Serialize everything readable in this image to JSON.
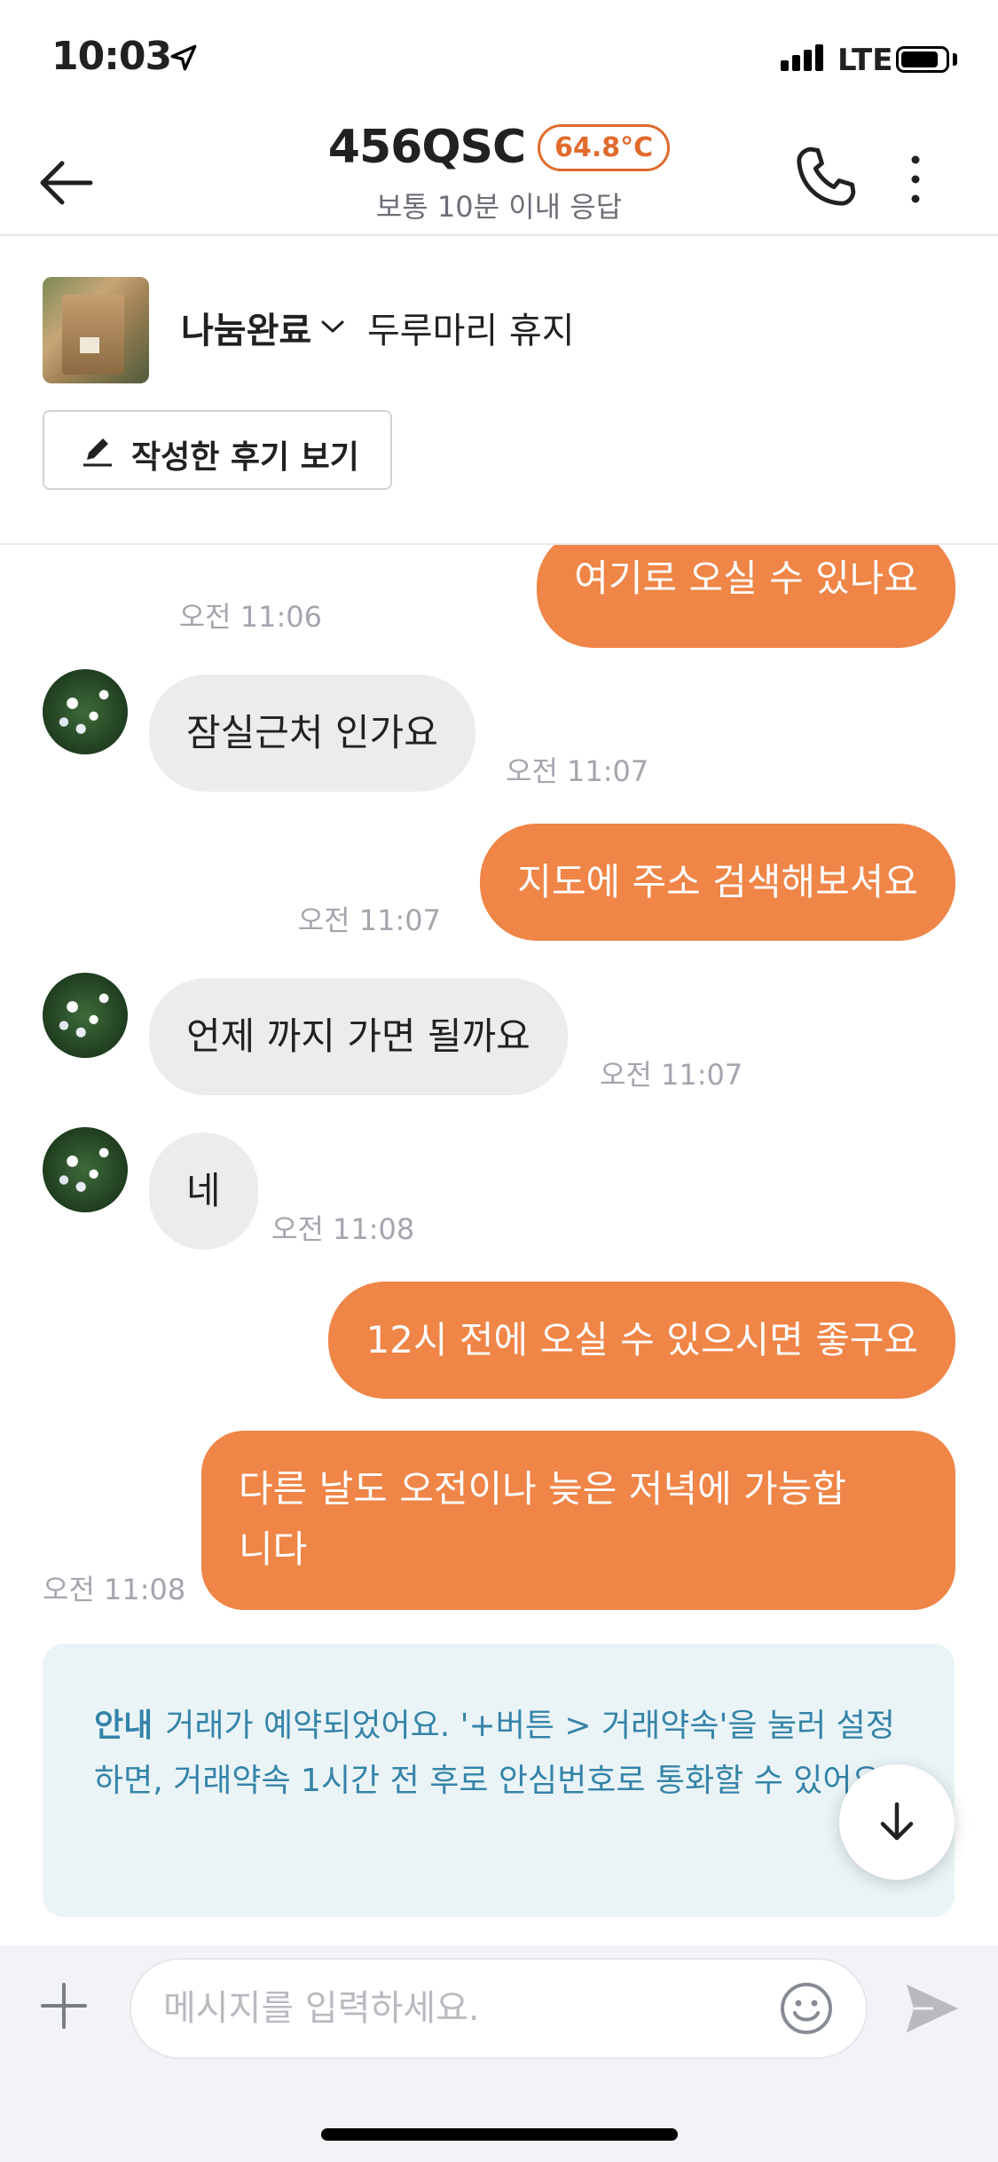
{
  "status_bar": {
    "time": "10:03",
    "network": "LTE",
    "battery_level": 0.85
  },
  "header": {
    "title": "456QSC",
    "manner_temp": "64.8°C",
    "subtitle": "보통 10분 이내 응답",
    "icons": {
      "back": "back-arrow-icon",
      "call": "phone-icon",
      "more": "more-vertical-icon"
    }
  },
  "product": {
    "status": "나눔완료",
    "name": "두루마리 휴지",
    "review_button": "작성한 후기 보기"
  },
  "messages": [
    {
      "sender": "me",
      "text": "여기로 오실 수 있나요",
      "time": "오전 11:06"
    },
    {
      "sender": "other",
      "text": "잠실근처 인가요",
      "time": "오전 11:07"
    },
    {
      "sender": "me",
      "text": "지도에 주소 검색해보셔요",
      "time": "오전 11:07"
    },
    {
      "sender": "other",
      "text": "언제 까지 가면 될까요",
      "time": "오전 11:07"
    },
    {
      "sender": "other",
      "text": "네",
      "time": "오전 11:08"
    },
    {
      "sender": "me",
      "text": "12시 전에 오실 수 있으시면 좋구요",
      "time": ""
    },
    {
      "sender": "me",
      "text": "다른 날도 오전이나 늦은 저녁에 가능합니다",
      "text_line1": "다른 날도 오전이나 늦은 저녁에 가능합",
      "text_line2": "니다",
      "time": "오전 11:08"
    }
  ],
  "notice": {
    "title": "안내",
    "text": "거래가 예약되었어요. '+버튼 > 거래약속'을 눌러 설정하면, 거래약속 1시간 전 후로 안심번호로 통화할 수 있어요."
  },
  "composer": {
    "placeholder": "메시지를 입력하세요."
  },
  "colors": {
    "accent": "#ef8547",
    "temp": "#e06b2c",
    "notice_bg": "#eaf4f7",
    "notice_text": "#3583a8"
  }
}
